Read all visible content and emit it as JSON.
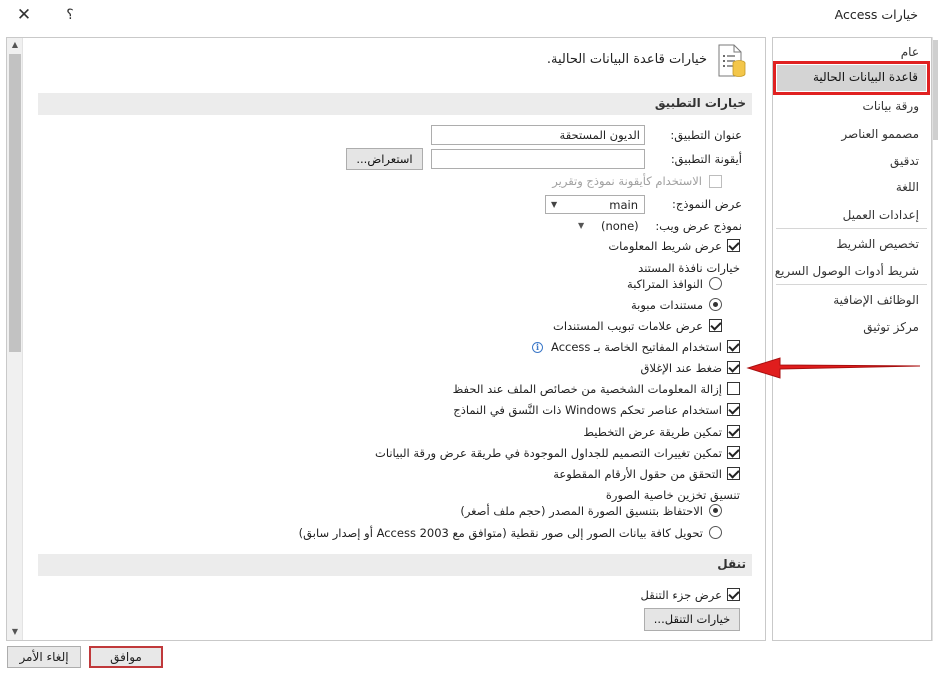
{
  "window": {
    "title": "خيارات Access",
    "help": "؟",
    "close": "✕"
  },
  "sidebar": {
    "items": [
      "عام",
      "قاعدة البيانات الحالية",
      "ورقة بيانات",
      "مصممو العناصر",
      "تدقيق",
      "اللغة",
      "إعدادات العميل",
      "تخصيص الشريط",
      "شريط أدوات الوصول السريع",
      "الوظائف الإضافية",
      "مركز توثيق"
    ],
    "selected_index": 1
  },
  "main": {
    "header": "خيارات قاعدة البيانات الحالية.",
    "app_options": {
      "title": "خيارات التطبيق",
      "app_title_label": "عنوان التطبيق:",
      "app_title_value": "الديون المستحقة",
      "app_icon_label": "أيقونة التطبيق:",
      "app_icon_value": "",
      "browse_button": "استعراض...",
      "use_as_icon": {
        "label": "الاستخدام كأيقونة نموذج وتقرير",
        "checked": false,
        "enabled": false
      },
      "display_form_label": "عرض النموذج:",
      "display_form_value": "main",
      "web_form_label": "نموذج عرض ويب:",
      "web_form_value": "(none)",
      "status_bar": {
        "label": "عرض شريط المعلومات",
        "checked": true
      },
      "doc_window_title": "خيارات نافذة المستند",
      "overlapping": {
        "label": "النوافذ المتراكبة",
        "checked": false
      },
      "tabbed": {
        "label": "مستندات مبوبة",
        "checked": true
      },
      "doc_tabs": {
        "label": "عرض علامات تبويب المستندات",
        "checked": true
      },
      "access_keys": {
        "label": "استخدام المفاتيح الخاصة بـ Access",
        "checked": true
      },
      "compact_on_close": {
        "label": "ضغط عند الإغلاق",
        "checked": true
      },
      "remove_personal": {
        "label": "إزالة المعلومات الشخصية من خصائص الملف عند الحفظ",
        "checked": false
      },
      "windows_themed": {
        "label": "استخدام عناصر تحكم Windows ذات النَّسق في النماذج",
        "checked": true
      },
      "layout_view": {
        "label": "تمكين طريقة عرض التخطيط",
        "checked": true
      },
      "design_changes": {
        "label": "تمكين تغييرات التصميم للجداول الموجودة في طريقة عرض ورقة البيانات",
        "checked": true
      },
      "truncated_fields": {
        "label": "التحقق من حقول الأرقام المقطوعة",
        "checked": true
      },
      "picture_format_title": "تنسيق تخزين خاصية الصورة",
      "preserve_format": {
        "label": "الاحتفاظ بتنسيق الصورة المصدر (حجم ملف أصغر)",
        "checked": true
      },
      "convert_bitmap": {
        "label": "تحويل كافة بيانات الصور إلى صور نقطية (متوافق مع Access 2003 أو إصدار سابق)",
        "checked": false
      }
    },
    "navigation": {
      "title": "تنقل",
      "show_nav_pane": {
        "label": "عرض جزء التنقل",
        "checked": true
      },
      "nav_options_button": "خيارات التنقل..."
    }
  },
  "footer": {
    "ok": "موافق",
    "cancel": "إلغاء الأمر"
  },
  "colors": {
    "highlight": "#e02020",
    "selected_bg": "#d4d4d4",
    "section_bg": "#ececec"
  }
}
